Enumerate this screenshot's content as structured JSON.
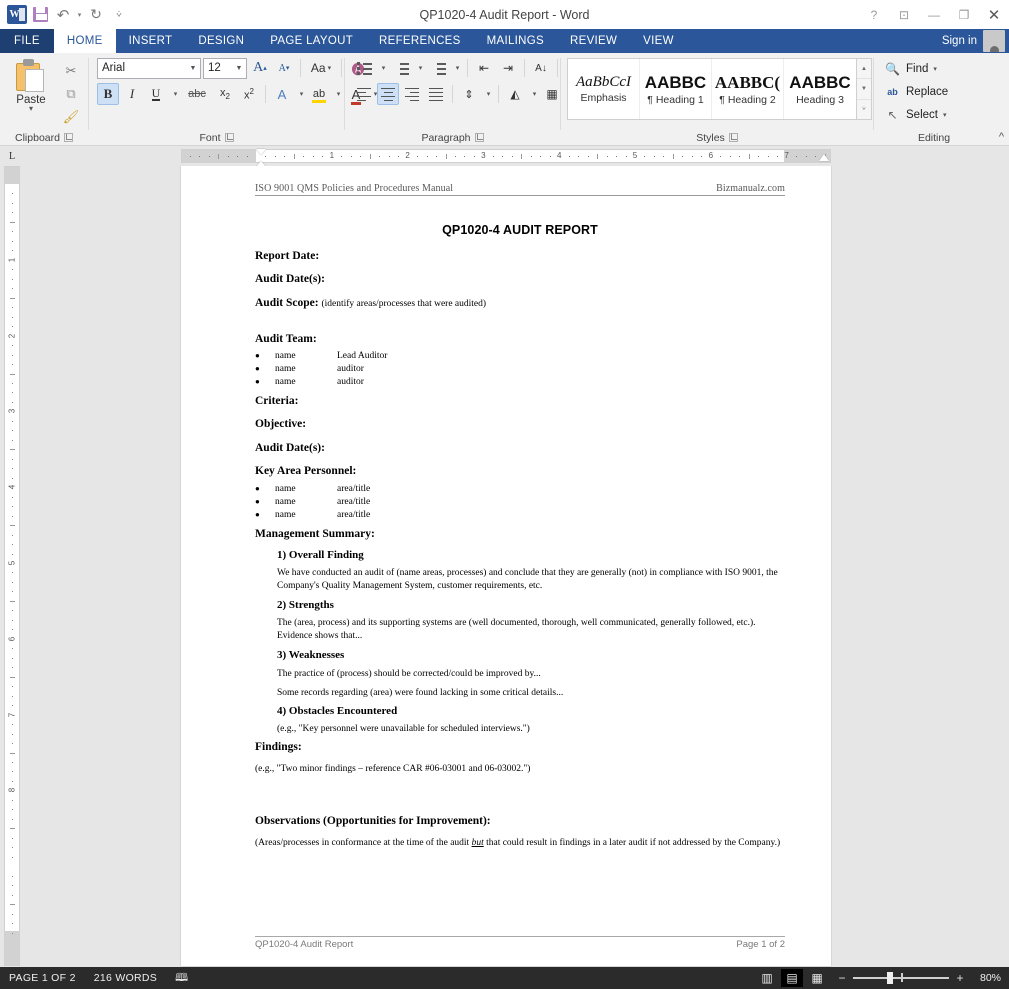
{
  "window": {
    "title": "QP1020-4 Audit Report - Word",
    "quick_access": [
      {
        "name": "word-logo",
        "label": "W"
      },
      {
        "name": "save",
        "label": "Save"
      },
      {
        "name": "undo",
        "label": "↶"
      },
      {
        "name": "undo-dropdown",
        "label": "▾"
      },
      {
        "name": "redo",
        "label": "↻"
      },
      {
        "name": "customize-qat",
        "label": "⇟"
      }
    ],
    "controls": [
      {
        "name": "help",
        "label": "?"
      },
      {
        "name": "ribbon-display-options",
        "label": "⊡"
      },
      {
        "name": "minimize",
        "label": "—"
      },
      {
        "name": "restore",
        "label": "❐"
      },
      {
        "name": "close",
        "label": "✕"
      }
    ]
  },
  "tabs": {
    "file": "FILE",
    "items": [
      "HOME",
      "INSERT",
      "DESIGN",
      "PAGE LAYOUT",
      "REFERENCES",
      "MAILINGS",
      "REVIEW",
      "VIEW"
    ],
    "active": "HOME",
    "sign_in": "Sign in"
  },
  "ribbon": {
    "clipboard": {
      "label": "Clipboard",
      "paste": "Paste",
      "paste_caret": "▾",
      "cut": "✂",
      "copy": "⧉",
      "format_painter": "🖌"
    },
    "font": {
      "label": "Font",
      "font_name": "Arial",
      "font_size": "12",
      "grow_font": "A",
      "shrink_font": "A",
      "change_case": "Aa",
      "clear_formatting": "A",
      "bold": "B",
      "italic": "I",
      "underline": "U",
      "strikethrough": "abc",
      "subscript": "x₂",
      "superscript": "x²",
      "text_effects": "A",
      "highlight": "ab",
      "font_color": "A",
      "caret": "▾"
    },
    "paragraph": {
      "label": "Paragraph",
      "bullets": "bullets",
      "numbering": "numbering",
      "multilevel": "multilevel",
      "decrease_indent": "⇤",
      "increase_indent": "⇥",
      "sort": "A↓",
      "show_marks": "¶",
      "align_left": "align-left",
      "align_center": "align-center",
      "align_right": "align-right",
      "justify": "justify",
      "line_spacing": "↕",
      "shading": "shading",
      "borders": "borders"
    },
    "styles": {
      "label": "Styles",
      "gallery": [
        {
          "preview": "AaBbCcI",
          "name": "Emphasis",
          "serif_italic": true
        },
        {
          "preview": "AABBC",
          "name": "¶ Heading 1",
          "serif_italic": false
        },
        {
          "preview": "AABBC(",
          "name": "¶ Heading 2",
          "serif_italic": false
        },
        {
          "preview": "AABBC",
          "name": "Heading 3",
          "serif_italic": false
        }
      ],
      "scroll_up": "▴",
      "scroll_down": "▾",
      "more": "▾"
    },
    "editing": {
      "label": "Editing",
      "find": "Find",
      "find_caret": "▾",
      "replace": "Replace",
      "select": "Select",
      "select_caret": "▾",
      "find_icon": "🔍",
      "replace_icon": "ab",
      "select_icon": "↖"
    },
    "collapse": "^"
  },
  "ruler": {
    "tab_stop_marker": "L",
    "horizontal_numbers": [
      "1",
      "2",
      "3",
      "4",
      "5",
      "6",
      "7"
    ],
    "vertical_numbers": [
      "1",
      "2",
      "3",
      "4",
      "5",
      "6",
      "7",
      "8"
    ]
  },
  "document": {
    "header_left": "ISO 9001 QMS Policies and Procedures Manual",
    "header_right": "Bizmanualz.com",
    "title": "QP1020-4 AUDIT REPORT",
    "fields": [
      {
        "label": "Report Date:",
        "hint": ""
      },
      {
        "label": "Audit Date(s):",
        "hint": ""
      },
      {
        "label": "Audit Scope:",
        "hint": "(identify areas/processes that were audited)"
      }
    ],
    "audit_team": {
      "label": "Audit Team:",
      "rows": [
        {
          "name": "name",
          "role": "Lead Auditor"
        },
        {
          "name": "name",
          "role": "auditor"
        },
        {
          "name": "name",
          "role": "auditor"
        }
      ]
    },
    "fields2": [
      {
        "label": "Criteria:",
        "hint": ""
      },
      {
        "label": "Objective:",
        "hint": ""
      },
      {
        "label": "Audit Date(s):",
        "hint": ""
      }
    ],
    "key_area_personnel": {
      "label": "Key Area Personnel:",
      "rows": [
        {
          "name": "name",
          "role": "area/title"
        },
        {
          "name": "name",
          "role": "area/title"
        },
        {
          "name": "name",
          "role": "area/title"
        }
      ]
    },
    "management_summary": {
      "label": "Management Summary:",
      "sections": [
        {
          "heading": "1) Overall Finding",
          "body": "We have conducted an audit of (name areas, processes) and conclude that they are generally (not) in compliance with ISO 9001, the Company's Quality Management System, customer requirements, etc."
        },
        {
          "heading": "2) Strengths",
          "body": "The (area, process) and its supporting systems are (well documented, thorough, well communicated, generally followed, etc.).  Evidence shows that..."
        },
        {
          "heading": "3) Weaknesses",
          "body": "The practice of (process) should be corrected/could be improved by...",
          "body2": "Some records regarding (area) were found lacking in some critical details..."
        },
        {
          "heading": "4) Obstacles Encountered",
          "body": "(e.g., \"Key personnel were unavailable for scheduled interviews.\")"
        }
      ]
    },
    "findings": {
      "label": "Findings:",
      "body": "(e.g., \"Two minor findings – reference CAR #06-03001 and 06-03002.\")"
    },
    "observations": {
      "label": "Observations (Opportunities for Improvement):",
      "body_part1": "(Areas/processes in conformance at the time of the audit ",
      "body_emphasis": "but",
      "body_part2": " that could result in findings in a later audit if not addressed by the Company.)"
    },
    "footer_left": "QP1020-4 Audit Report",
    "footer_right": "Page 1 of 2"
  },
  "status_bar": {
    "page": "PAGE 1 OF 2",
    "words": "216 WORDS",
    "proofing_icon": "proofing-errors-icon",
    "views": [
      {
        "name": "read-mode",
        "glyph": "▥",
        "active": false
      },
      {
        "name": "print-layout",
        "glyph": "▤",
        "active": true
      },
      {
        "name": "web-layout",
        "glyph": "▦",
        "active": false
      }
    ],
    "zoom_out": "−",
    "zoom_in": "+",
    "zoom_level": "80%"
  }
}
